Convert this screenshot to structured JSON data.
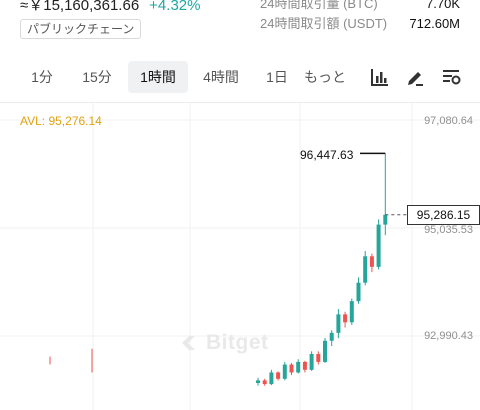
{
  "ticker": {
    "price_jpy": "≈￥15,160,361.66",
    "change": "+4.32%",
    "chain_badge": "パブリックチェーン"
  },
  "stats": [
    {
      "label": "24時間取引量 (BTC)",
      "value": "7.70K"
    },
    {
      "label": "24時間取引額 (USDT)",
      "value": "712.60M"
    }
  ],
  "intervals": [
    {
      "label": "1分",
      "active": false
    },
    {
      "label": "15分",
      "active": false
    },
    {
      "label": "1時間",
      "active": true
    },
    {
      "label": "4時間",
      "active": false
    },
    {
      "label": "1日",
      "active": false
    },
    {
      "label": "もっと",
      "active": false
    }
  ],
  "toolbar": {
    "icons": [
      "bar-chart-icon",
      "draw-pen-icon",
      "indicator-settings-icon"
    ]
  },
  "chart": {
    "avl_label": "AVL: 95,276.14",
    "y_axis_labels": [
      "97,080.64",
      "95,035.53",
      "92,990.43"
    ],
    "high_label": "96,447.63",
    "current_price": "95,286.15",
    "watermark": "Bitget"
  },
  "colors": {
    "up": "#26a69a",
    "down": "#ef5350",
    "accent_change": "#1fa7a0",
    "avl": "#e0a210"
  },
  "chart_data": {
    "type": "candlestick",
    "interval": "1時間",
    "y_ticks": [
      97080.64,
      95035.53,
      92990.43
    ],
    "high": 96447.63,
    "last": 95286.15,
    "candles": [
      {
        "o": 92100,
        "h": 92200,
        "l": 92050,
        "c": 92150
      },
      {
        "o": 92150,
        "h": 92180,
        "l": 92050,
        "c": 92080
      },
      {
        "o": 92080,
        "h": 92350,
        "l": 92060,
        "c": 92300
      },
      {
        "o": 92300,
        "h": 92320,
        "l": 92150,
        "c": 92180
      },
      {
        "o": 92180,
        "h": 92500,
        "l": 92150,
        "c": 92450
      },
      {
        "o": 92450,
        "h": 92480,
        "l": 92250,
        "c": 92300
      },
      {
        "o": 92300,
        "h": 92550,
        "l": 92280,
        "c": 92500
      },
      {
        "o": 92500,
        "h": 92520,
        "l": 92300,
        "c": 92350
      },
      {
        "o": 92350,
        "h": 92700,
        "l": 92330,
        "c": 92650
      },
      {
        "o": 92650,
        "h": 92700,
        "l": 92450,
        "c": 92500
      },
      {
        "o": 92500,
        "h": 92950,
        "l": 92480,
        "c": 92900
      },
      {
        "o": 92900,
        "h": 93100,
        "l": 92800,
        "c": 93050
      },
      {
        "o": 93050,
        "h": 93500,
        "l": 92950,
        "c": 93400
      },
      {
        "o": 93400,
        "h": 93450,
        "l": 93150,
        "c": 93250
      },
      {
        "o": 93250,
        "h": 93700,
        "l": 93200,
        "c": 93650
      },
      {
        "o": 93650,
        "h": 94100,
        "l": 93600,
        "c": 94000
      },
      {
        "o": 94000,
        "h": 94600,
        "l": 93950,
        "c": 94500
      },
      {
        "o": 94500,
        "h": 94550,
        "l": 94200,
        "c": 94300
      },
      {
        "o": 94300,
        "h": 95200,
        "l": 94250,
        "c": 95100
      },
      {
        "o": 95100,
        "h": 96447.63,
        "l": 94900,
        "c": 95286.15
      }
    ]
  }
}
